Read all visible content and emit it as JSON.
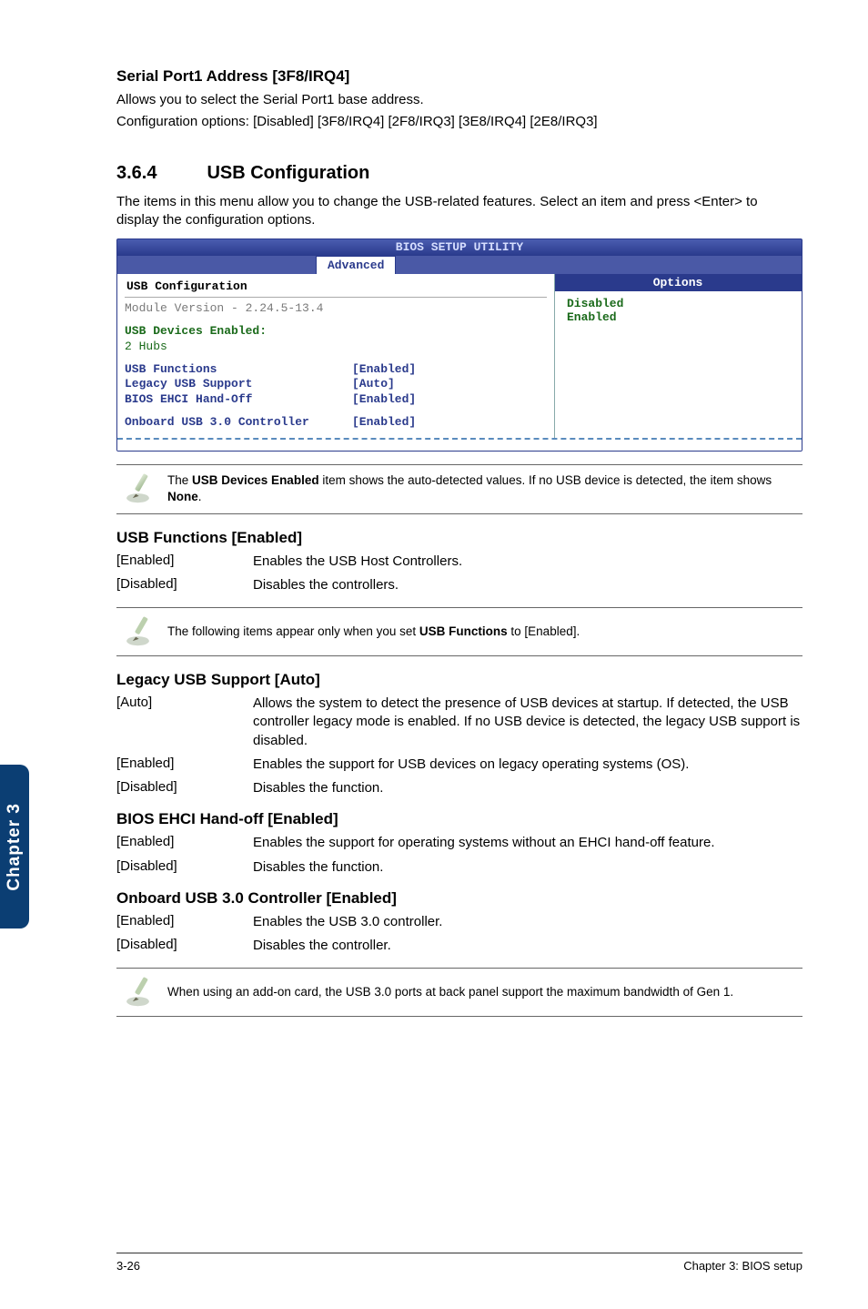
{
  "serial": {
    "heading": "Serial Port1 Address [3F8/IRQ4]",
    "line1": "Allows you to select the Serial Port1 base address.",
    "line2": "Configuration options: [Disabled] [3F8/IRQ4] [2F8/IRQ3] [3E8/IRQ4] [2E8/IRQ3]"
  },
  "section": {
    "num": "3.6.4",
    "title": "USB Configuration",
    "intro": "The items in this menu allow you to change the USB-related features. Select an item and press <Enter> to display the configuration options."
  },
  "bios": {
    "title": "BIOS SETUP UTILITY",
    "tab": "Advanced",
    "left": {
      "heading": "USB Configuration",
      "module": "Module Version - 2.24.5-13.4",
      "devtitle": "USB Devices Enabled:",
      "devline": " 2 Hubs",
      "rows": [
        {
          "label": "USB Functions",
          "value": "[Enabled]"
        },
        {
          "label": "Legacy USB Support",
          "value": "[Auto]"
        },
        {
          "label": "BIOS EHCI Hand-Off",
          "value": "[Enabled]"
        }
      ],
      "row2": {
        "label": "Onboard USB 3.0 Controller",
        "value": "[Enabled]"
      }
    },
    "right": {
      "title": "Options",
      "disabled": "Disabled",
      "enabled": "Enabled"
    }
  },
  "note1": "The USB Devices Enabled item shows the auto-detected values. If no USB device is detected, the item shows None.",
  "note1_bold1": "USB Devices Enabled",
  "note1_bold2": "None",
  "usbfunc": {
    "heading": "USB Functions [Enabled]",
    "items": [
      {
        "k": "[Enabled]",
        "v": "Enables the USB Host Controllers."
      },
      {
        "k": "[Disabled]",
        "v": "Disables the controllers."
      }
    ]
  },
  "note2": "The following items appear only when you set USB Functions to [Enabled].",
  "note2_bold": "USB Functions",
  "legacy": {
    "heading": "Legacy USB Support [Auto]",
    "items": [
      {
        "k": "[Auto]",
        "v": "Allows the system to detect the presence of USB devices at startup. If detected, the USB controller legacy mode is enabled. If no USB device is detected, the legacy USB support is disabled."
      },
      {
        "k": "[Enabled]",
        "v": "Enables the support for USB devices on legacy operating systems (OS)."
      },
      {
        "k": "[Disabled]",
        "v": "Disables the function."
      }
    ]
  },
  "ehci": {
    "heading": "BIOS EHCI Hand-off [Enabled]",
    "items": [
      {
        "k": "[Enabled]",
        "v": "Enables the support for operating systems without an EHCI hand-off feature."
      },
      {
        "k": "[Disabled]",
        "v": "Disables the function."
      }
    ]
  },
  "usb30": {
    "heading": "Onboard USB 3.0 Controller [Enabled]",
    "items": [
      {
        "k": "[Enabled]",
        "v": "Enables the USB 3.0 controller."
      },
      {
        "k": "[Disabled]",
        "v": "Disables the controller."
      }
    ]
  },
  "note3": "When using an add-on card, the USB 3.0 ports at back panel support the maximum bandwidth of Gen 1.",
  "sidetab": "Chapter 3",
  "footer": {
    "left": "3-26",
    "right": "Chapter 3: BIOS setup"
  }
}
